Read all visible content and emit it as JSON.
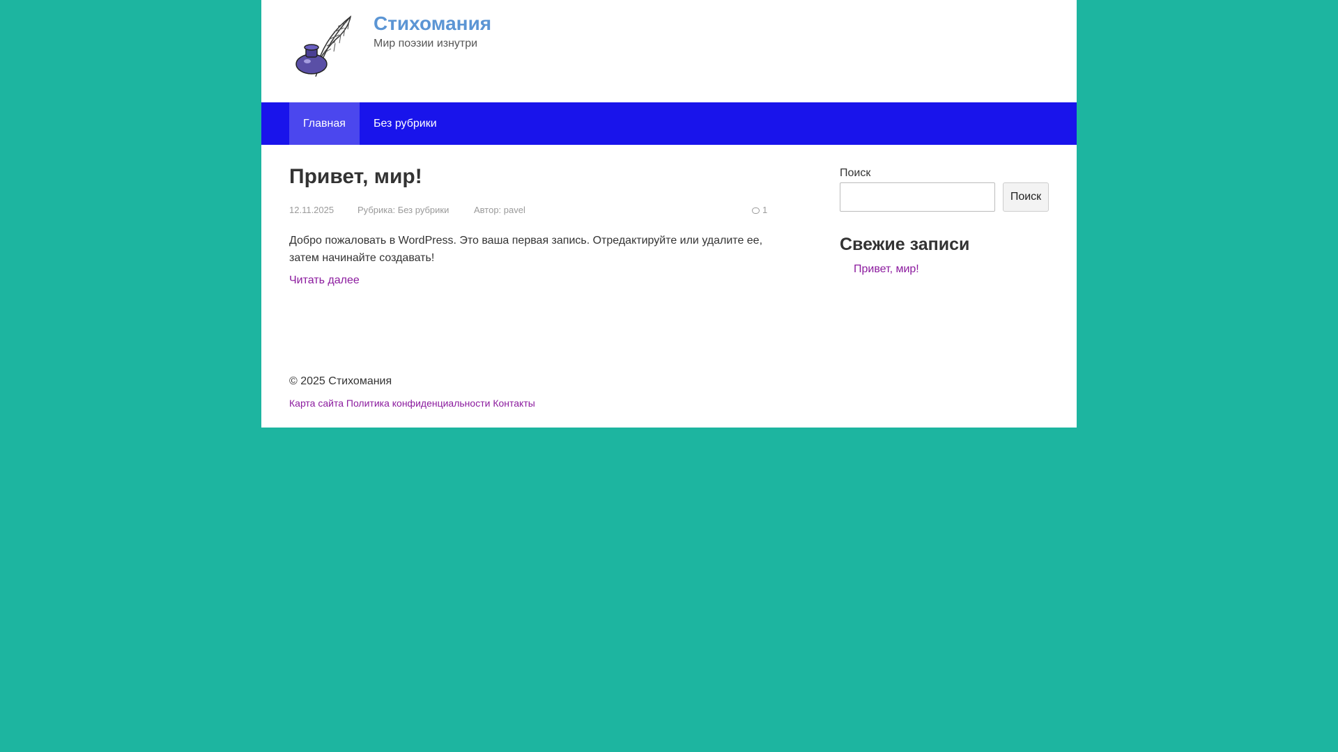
{
  "header": {
    "site_title": "Стихомания",
    "site_description": "Мир поэзии изнутри",
    "logo_icon": "inkwell-feather-icon"
  },
  "nav": {
    "items": [
      {
        "label": "Главная",
        "active": true
      },
      {
        "label": "Без рубрики",
        "active": false
      }
    ]
  },
  "post": {
    "title": "Привет, мир!",
    "date": "12.11.2025",
    "category_prefix": "Рубрика:",
    "category": "Без рубрики",
    "author_prefix": "Автор:",
    "author": "pavel",
    "comments_count": "1",
    "excerpt": "Добро пожаловать в WordPress. Это ваша первая запись. Отредактируйте или удалите ее, затем начинайте создавать!",
    "read_more": "Читать далее"
  },
  "sidebar": {
    "search_label": "Поиск",
    "search_value": "",
    "search_button": "Поиск",
    "recent_title": "Свежие записи",
    "recent_posts": [
      "Привет, мир!"
    ]
  },
  "footer": {
    "copyright": "© 2025 Стихомания",
    "links": [
      "Карта сайта",
      "Политика конфиденциальности",
      "Контакты"
    ]
  },
  "colors": {
    "background": "#1db5a0",
    "nav": "#1914eb",
    "nav_active": "#4b47ee",
    "title": "#5b95d4",
    "link": "#8b1a9e"
  }
}
